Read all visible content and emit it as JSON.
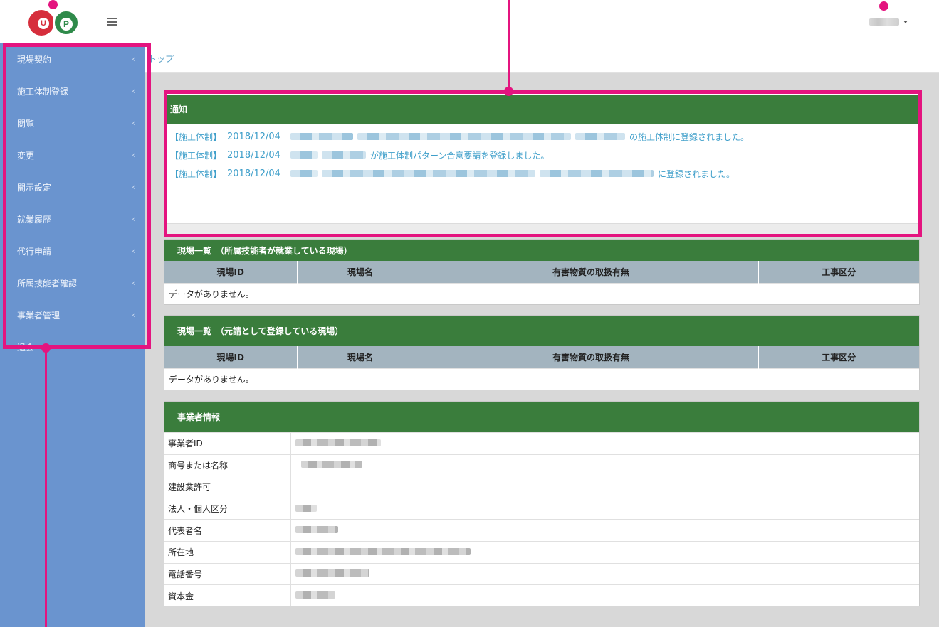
{
  "header": {
    "logo_text_left": "U",
    "logo_text_right": "P",
    "menu_icon": "hamburger-icon",
    "user_caret_icon": "caret-down-icon"
  },
  "sidebar": {
    "items": [
      {
        "label": "現場契約",
        "icon": "chevron-left-icon"
      },
      {
        "label": "施工体制登録",
        "icon": "chevron-left-icon"
      },
      {
        "label": "閲覧",
        "icon": "chevron-left-icon"
      },
      {
        "label": "変更",
        "icon": "chevron-left-icon"
      },
      {
        "label": "開示設定",
        "icon": "chevron-left-icon"
      },
      {
        "label": "就業履歴",
        "icon": "chevron-left-icon"
      },
      {
        "label": "代行申請",
        "icon": "chevron-left-icon"
      },
      {
        "label": "所属技能者確認",
        "icon": "chevron-left-icon"
      },
      {
        "label": "事業者管理",
        "icon": "chevron-left-icon"
      },
      {
        "label": "退会",
        "icon": "chevron-left-icon"
      }
    ]
  },
  "breadcrumb": {
    "label": "トップ"
  },
  "notice": {
    "title": "通知",
    "items": [
      {
        "tag": "【施工体制】",
        "date": "2018/12/04",
        "suffix": "の施工体制に登録されました。"
      },
      {
        "tag": "【施工体制】",
        "date": "2018/12/04",
        "suffix": "が施工体制パターン合意要請を登録しました。"
      },
      {
        "tag": "【施工体制】",
        "date": "2018/12/04",
        "suffix": "に登録されました。"
      }
    ]
  },
  "sites_employed": {
    "title": "現場一覧　（所属技能者が就業している現場）",
    "columns": [
      "現場ID",
      "現場名",
      "有害物質の取扱有無",
      "工事区分"
    ],
    "empty": "データがありません。"
  },
  "sites_prime": {
    "title": "現場一覧　（元請として登録している現場）",
    "columns": [
      "現場ID",
      "現場名",
      "有害物質の取扱有無",
      "工事区分"
    ],
    "empty": "データがありません。"
  },
  "company_info": {
    "title": "事業者情報",
    "rows": [
      {
        "label": "事業者ID"
      },
      {
        "label": "商号または名称"
      },
      {
        "label": "建設業許可"
      },
      {
        "label": "法人・個人区分"
      },
      {
        "label": "代表者名"
      },
      {
        "label": "所在地"
      },
      {
        "label": "電話番号"
      },
      {
        "label": "資本金"
      }
    ]
  },
  "colors": {
    "accent_green": "#3a7d3c",
    "sidebar_blue": "#6a94cf",
    "highlight_magenta": "#e4147f",
    "link_blue": "#3f9fca"
  }
}
